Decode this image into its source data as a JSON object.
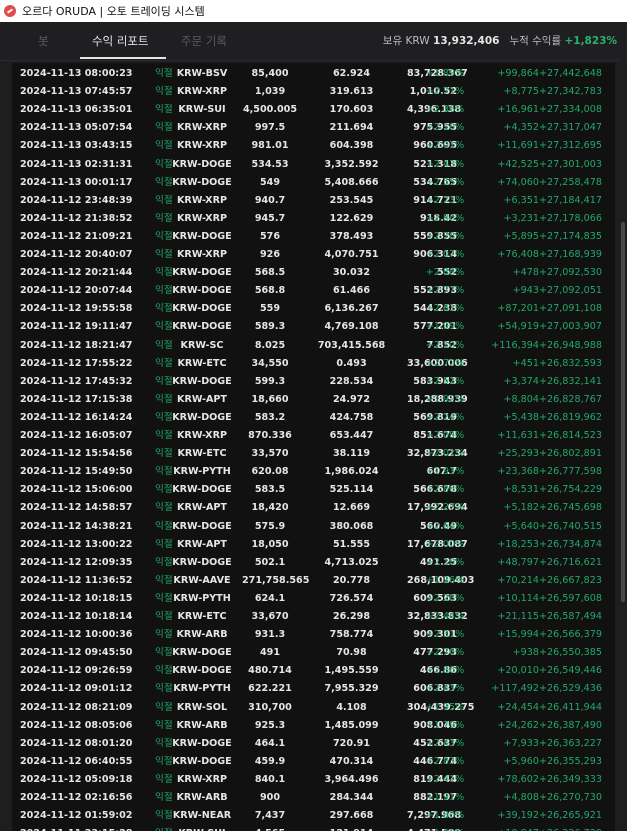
{
  "window": {
    "title": "오르다 ORUDA | 오토 트레이딩 시스템"
  },
  "tabs": [
    {
      "label": "봇"
    },
    {
      "label": "수익 리포트"
    },
    {
      "label": "주문 기록"
    }
  ],
  "header": {
    "holdings_label": "보유 KRW",
    "holdings_value": "13,932,406",
    "cum_label": "누적 수익률",
    "cum_value": "+1,823%"
  },
  "colors": {
    "positive": "#23a86a",
    "text": "#e6e6e6",
    "panel": "#111111"
  },
  "rows": [
    {
      "time": "2024-11-13 08:00:23",
      "kind": "익절",
      "symbol": "KRW-BSV",
      "price": "85,400",
      "qty": "62.924",
      "amount": "83,728.367",
      "rate": "+1.89%",
      "pnl": "+99,864",
      "total": "+27,442,648"
    },
    {
      "time": "2024-11-13 07:45:57",
      "kind": "익절",
      "symbol": "KRW-XRP",
      "price": "1,039",
      "qty": "319.613",
      "amount": "1,010.52",
      "rate": "+2.71%",
      "pnl": "+8,775",
      "total": "+27,342,783"
    },
    {
      "time": "2024-11-13 06:35:01",
      "kind": "익절",
      "symbol": "KRW-SUI",
      "price": "4,500.005",
      "qty": "170.603",
      "amount": "4,396.138",
      "rate": "+2.36%",
      "pnl": "+16,961",
      "total": "+27,334,008"
    },
    {
      "time": "2024-11-13 05:07:54",
      "kind": "익절",
      "symbol": "KRW-XRP",
      "price": "997.5",
      "qty": "211.694",
      "amount": "975.955",
      "rate": "+2.10%",
      "pnl": "+4,352",
      "total": "+27,317,047"
    },
    {
      "time": "2024-11-13 03:43:15",
      "kind": "익절",
      "symbol": "KRW-XRP",
      "price": "981.01",
      "qty": "604.398",
      "amount": "960.695",
      "rate": "+2.01%",
      "pnl": "+11,691",
      "total": "+27,312,695"
    },
    {
      "time": "2024-11-13 02:31:31",
      "kind": "익절",
      "symbol": "KRW-DOGE",
      "price": "534.53",
      "qty": "3,352.592",
      "amount": "521.318",
      "rate": "+2.43%",
      "pnl": "+42,525",
      "total": "+27,301,003"
    },
    {
      "time": "2024-11-13 00:01:17",
      "kind": "익절",
      "symbol": "KRW-DOGE",
      "price": "549",
      "qty": "5,408.666",
      "amount": "534.765",
      "rate": "+2.55%",
      "pnl": "+74,060",
      "total": "+27,258,478"
    },
    {
      "time": "2024-11-12 23:48:39",
      "kind": "익절",
      "symbol": "KRW-XRP",
      "price": "940.7",
      "qty": "253.545",
      "amount": "914.721",
      "rate": "+2.73%",
      "pnl": "+6,351",
      "total": "+27,184,417"
    },
    {
      "time": "2024-11-12 21:38:52",
      "kind": "익절",
      "symbol": "KRW-XRP",
      "price": "945.7",
      "qty": "122.629",
      "amount": "918.42",
      "rate": "+2.86%",
      "pnl": "+3,231",
      "total": "+27,178,066"
    },
    {
      "time": "2024-11-12 21:09:21",
      "kind": "익절",
      "symbol": "KRW-DOGE",
      "price": "576",
      "qty": "378.493",
      "amount": "559.855",
      "rate": "+2.78%",
      "pnl": "+5,895",
      "total": "+27,174,835"
    },
    {
      "time": "2024-11-12 20:40:07",
      "kind": "익절",
      "symbol": "KRW-XRP",
      "price": "926",
      "qty": "4,070.751",
      "amount": "906.314",
      "rate": "+2.07%",
      "pnl": "+76,408",
      "total": "+27,168,939"
    },
    {
      "time": "2024-11-12 20:21:44",
      "kind": "익절",
      "symbol": "KRW-DOGE",
      "price": "568.5",
      "qty": "30.032",
      "amount": "552",
      "rate": "+2.88%",
      "pnl": "+478",
      "total": "+27,092,530"
    },
    {
      "time": "2024-11-12 20:07:44",
      "kind": "익절",
      "symbol": "KRW-DOGE",
      "price": "568.8",
      "qty": "61.466",
      "amount": "552.893",
      "rate": "+2.77%",
      "pnl": "+943",
      "total": "+27,092,051"
    },
    {
      "time": "2024-11-12 19:55:58",
      "kind": "익절",
      "symbol": "KRW-DOGE",
      "price": "559",
      "qty": "6,136.267",
      "amount": "544.238",
      "rate": "+2.61%",
      "pnl": "+87,201",
      "total": "+27,091,108"
    },
    {
      "time": "2024-11-12 19:11:47",
      "kind": "익절",
      "symbol": "KRW-DOGE",
      "price": "589.3",
      "qty": "4,769.108",
      "amount": "577.201",
      "rate": "+1.99%",
      "pnl": "+54,919",
      "total": "+27,003,907"
    },
    {
      "time": "2024-11-12 18:21:47",
      "kind": "익절",
      "symbol": "KRW-SC",
      "price": "8.025",
      "qty": "703,415.568",
      "amount": "7.852",
      "rate": "+2.10%",
      "pnl": "+116,394",
      "total": "+26,948,988"
    },
    {
      "time": "2024-11-12 17:55:22",
      "kind": "익절",
      "symbol": "KRW-ETC",
      "price": "34,550",
      "qty": "0.493",
      "amount": "33,600.006",
      "rate": "+2.72%",
      "pnl": "+451",
      "total": "+26,832,593"
    },
    {
      "time": "2024-11-12 17:45:32",
      "kind": "익절",
      "symbol": "KRW-DOGE",
      "price": "599.3",
      "qty": "228.534",
      "amount": "583.943",
      "rate": "+2.52%",
      "pnl": "+3,374",
      "total": "+26,832,141"
    },
    {
      "time": "2024-11-12 17:15:38",
      "kind": "익절",
      "symbol": "KRW-APT",
      "price": "18,660",
      "qty": "24.972",
      "amount": "18,288.939",
      "rate": "+1.92%",
      "pnl": "+8,804",
      "total": "+26,828,767"
    },
    {
      "time": "2024-11-12 16:14:24",
      "kind": "익절",
      "symbol": "KRW-DOGE",
      "price": "583.2",
      "qty": "424.758",
      "amount": "569.819",
      "rate": "+2.24%",
      "pnl": "+5,438",
      "total": "+26,819,962"
    },
    {
      "time": "2024-11-12 16:05:07",
      "kind": "익절",
      "symbol": "KRW-XRP",
      "price": "870.336",
      "qty": "653.447",
      "amount": "851.674",
      "rate": "+2.08%",
      "pnl": "+11,631",
      "total": "+26,814,523"
    },
    {
      "time": "2024-11-12 15:54:56",
      "kind": "익절",
      "symbol": "KRW-ETC",
      "price": "33,570",
      "qty": "38.119",
      "amount": "32,873.234",
      "rate": "+2.01%",
      "pnl": "+25,293",
      "total": "+26,802,891"
    },
    {
      "time": "2024-11-12 15:49:50",
      "kind": "익절",
      "symbol": "KRW-PYTH",
      "price": "620.08",
      "qty": "1,986.024",
      "amount": "607.7",
      "rate": "+1.93%",
      "pnl": "+23,368",
      "total": "+26,777,598"
    },
    {
      "time": "2024-11-12 15:06:00",
      "kind": "익절",
      "symbol": "KRW-DOGE",
      "price": "583.5",
      "qty": "525.114",
      "amount": "566.678",
      "rate": "+2.86%",
      "pnl": "+8,531",
      "total": "+26,754,229"
    },
    {
      "time": "2024-11-12 14:58:57",
      "kind": "익절",
      "symbol": "KRW-APT",
      "price": "18,420",
      "qty": "12.669",
      "amount": "17,992.694",
      "rate": "+2.27%",
      "pnl": "+5,182",
      "total": "+26,745,698"
    },
    {
      "time": "2024-11-12 14:38:21",
      "kind": "익절",
      "symbol": "KRW-DOGE",
      "price": "575.9",
      "qty": "380.068",
      "amount": "560.49",
      "rate": "+2.64%",
      "pnl": "+5,640",
      "total": "+26,740,515"
    },
    {
      "time": "2024-11-12 13:00:22",
      "kind": "익절",
      "symbol": "KRW-APT",
      "price": "18,050",
      "qty": "51.555",
      "amount": "17,678.087",
      "rate": "+2.00%",
      "pnl": "+18,253",
      "total": "+26,734,874"
    },
    {
      "time": "2024-11-12 12:09:35",
      "kind": "익절",
      "symbol": "KRW-DOGE",
      "price": "502.1",
      "qty": "4,713.025",
      "amount": "491.25",
      "rate": "+2.10%",
      "pnl": "+48,797",
      "total": "+26,716,621"
    },
    {
      "time": "2024-11-12 11:36:52",
      "kind": "익절",
      "symbol": "KRW-AAVE",
      "price": "271,758.565",
      "qty": "20.778",
      "amount": "268,109.403",
      "rate": "+1.26%",
      "pnl": "+70,214",
      "total": "+26,667,823"
    },
    {
      "time": "2024-11-12 10:18:15",
      "kind": "익절",
      "symbol": "KRW-PYTH",
      "price": "624.1",
      "qty": "726.574",
      "amount": "609.563",
      "rate": "+2.28%",
      "pnl": "+10,114",
      "total": "+26,597,608"
    },
    {
      "time": "2024-11-12 10:18:14",
      "kind": "익절",
      "symbol": "KRW-ETC",
      "price": "33,670",
      "qty": "26.298",
      "amount": "32,833.832",
      "rate": "+2.44%",
      "pnl": "+21,115",
      "total": "+26,587,494"
    },
    {
      "time": "2024-11-12 10:00:36",
      "kind": "익절",
      "symbol": "KRW-ARB",
      "price": "931.3",
      "qty": "758.774",
      "amount": "909.301",
      "rate": "+2.31%",
      "pnl": "+15,994",
      "total": "+26,566,379"
    },
    {
      "time": "2024-11-12 09:45:50",
      "kind": "익절",
      "symbol": "KRW-DOGE",
      "price": "491",
      "qty": "70.98",
      "amount": "477.293",
      "rate": "+2.76%",
      "pnl": "+938",
      "total": "+26,550,385"
    },
    {
      "time": "2024-11-12 09:26:59",
      "kind": "익절",
      "symbol": "KRW-DOGE",
      "price": "480.714",
      "qty": "1,495.559",
      "amount": "466.86",
      "rate": "+2.86%",
      "pnl": "+20,010",
      "total": "+26,549,446"
    },
    {
      "time": "2024-11-12 09:01:12",
      "kind": "익절",
      "symbol": "KRW-PYTH",
      "price": "622.221",
      "qty": "7,955.329",
      "amount": "606.837",
      "rate": "+2.43%",
      "pnl": "+117,492",
      "total": "+26,529,436"
    },
    {
      "time": "2024-11-12 08:21:09",
      "kind": "익절",
      "symbol": "KRW-SOL",
      "price": "310,700",
      "qty": "4.108",
      "amount": "304,439.275",
      "rate": "+1.95%",
      "pnl": "+24,454",
      "total": "+26,411,944"
    },
    {
      "time": "2024-11-12 08:05:06",
      "kind": "익절",
      "symbol": "KRW-ARB",
      "price": "925.3",
      "qty": "1,485.099",
      "amount": "908.046",
      "rate": "+1.79%",
      "pnl": "+24,262",
      "total": "+26,387,490"
    },
    {
      "time": "2024-11-12 08:01:20",
      "kind": "익절",
      "symbol": "KRW-DOGE",
      "price": "464.1",
      "qty": "720.91",
      "amount": "452.637",
      "rate": "+2.43%",
      "pnl": "+7,933",
      "total": "+26,363,227"
    },
    {
      "time": "2024-11-12 06:40:55",
      "kind": "익절",
      "symbol": "KRW-DOGE",
      "price": "459.9",
      "qty": "470.314",
      "amount": "446.774",
      "rate": "+2.83%",
      "pnl": "+5,960",
      "total": "+26,355,293"
    },
    {
      "time": "2024-11-12 05:09:18",
      "kind": "익절",
      "symbol": "KRW-XRP",
      "price": "840.1",
      "qty": "3,964.496",
      "amount": "819.444",
      "rate": "+2.41%",
      "pnl": "+78,602",
      "total": "+26,349,333"
    },
    {
      "time": "2024-11-12 02:16:56",
      "kind": "익절",
      "symbol": "KRW-ARB",
      "price": "900",
      "qty": "284.344",
      "amount": "882.197",
      "rate": "+1.91%",
      "pnl": "+4,808",
      "total": "+26,270,730"
    },
    {
      "time": "2024-11-12 01:59:02",
      "kind": "익절",
      "symbol": "KRW-NEAR",
      "price": "7,437",
      "qty": "297.668",
      "amount": "7,297.968",
      "rate": "+1.80%",
      "pnl": "+39,192",
      "total": "+26,265,921"
    },
    {
      "time": "2024-11-11 23:15:28",
      "kind": "익절",
      "symbol": "KRW-SUI",
      "price": "4,565",
      "qty": "121.914",
      "amount": "4,471.509",
      "rate": "+1.98%",
      "pnl": "+10,847",
      "total": "+26,226,729"
    }
  ]
}
